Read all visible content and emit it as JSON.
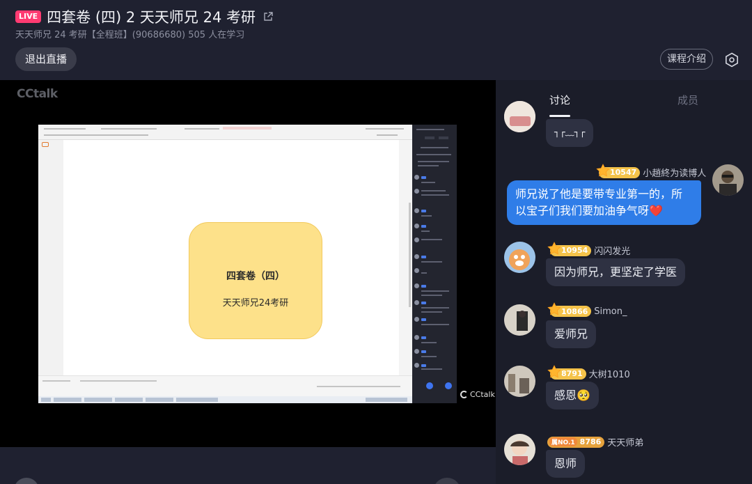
{
  "header": {
    "live_badge": "LIVE",
    "title": "四套卷 (四) 2 天天师兄 24 考研",
    "subtitle": "天天师兄 24 考研【全程班】(90686680)  505 人在学习",
    "exit_button": "退出直播",
    "intro_button": "课程介绍"
  },
  "video": {
    "logo": "CCtalk",
    "watermark": "CCtalk",
    "slide_title": "四套卷（四）",
    "slide_subtitle": "天天师兄24考研"
  },
  "panel": {
    "tabs": [
      {
        "label": "讨论",
        "active": true
      },
      {
        "label": "成员",
        "active": false
      }
    ],
    "messages": [
      {
        "user": "",
        "level": "",
        "text": "┐┌﹏┐┌"
      },
      {
        "user": "小趙終为读博人",
        "level": "10547",
        "text": "师兄说了他是要带专业第一的，所以宝子们我们要加油争气呀❤️",
        "self": true
      },
      {
        "user": "闪闪发光",
        "level": "10954",
        "text": "因为师兄，更坚定了学医"
      },
      {
        "user": "Simon_",
        "level": "10866",
        "text": "爱师兄"
      },
      {
        "user": "大树1010",
        "level": "8791",
        "text": "感恩🥺"
      },
      {
        "user": "天天师弟",
        "level": "8786",
        "crown": "属NO.1",
        "text": "恩师"
      }
    ]
  },
  "colors": {
    "live": "#ff3b72",
    "self_bubble": "#2f7de8",
    "level_badge": "#f5c34a"
  }
}
